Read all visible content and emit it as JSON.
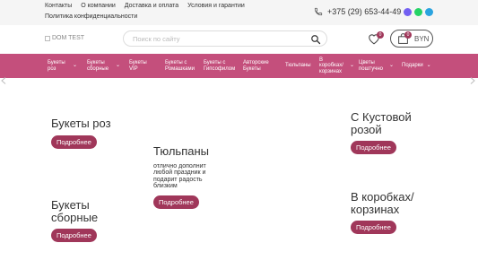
{
  "topbar": {
    "links_row1": [
      "Контакты",
      "О компании",
      "Доставка и оплата",
      "Условия и гарантии"
    ],
    "links_row2": [
      "Политика конфиденциальности"
    ],
    "phone": "+375 (29) 653-44-49",
    "messengers": [
      {
        "icon": "viber-icon",
        "color": "#7360f2"
      },
      {
        "icon": "whatsapp-icon",
        "color": "#25d366"
      },
      {
        "icon": "telegram-icon",
        "color": "#2aa3df"
      }
    ]
  },
  "header": {
    "logo_alt": "DOM TEST",
    "search_placeholder": "Поиск по сайту",
    "favorites_count": "0",
    "cart_count": "0",
    "currency": "BYN"
  },
  "nav": {
    "items": [
      {
        "label": "Букеты роз",
        "dropdown": true
      },
      {
        "label": "Букеты сборные",
        "dropdown": true
      },
      {
        "label": "Букеты VIP",
        "dropdown": false
      },
      {
        "label": "Букеты с Ромашками",
        "dropdown": false
      },
      {
        "label": "Букеты с Гипсофилом",
        "dropdown": false
      },
      {
        "label": "Авторские Букеты",
        "dropdown": false
      },
      {
        "label": "Тюльпаны",
        "dropdown": false
      },
      {
        "label": "В коробках/ корзинах",
        "dropdown": true
      },
      {
        "label": "Цветы поштучно",
        "dropdown": true
      },
      {
        "label": "Подарки",
        "dropdown": true
      }
    ]
  },
  "categories": [
    {
      "title": "Букеты роз",
      "desc": "",
      "button": "Подробнее"
    },
    {
      "title": "Тюльпаны",
      "desc": "отлично дополнит любой праздник и подарит радость близким",
      "button": "Подробнее"
    },
    {
      "title": "С Кустовой розой",
      "desc": "",
      "button": "Подробнее"
    },
    {
      "title": "Букеты сборные",
      "desc": "",
      "button": "Подробнее"
    },
    {
      "title": "В коробках/ корзинах",
      "desc": "",
      "button": "Подробнее"
    }
  ],
  "colors": {
    "accent": "#c44f7c",
    "button": "#a0375a"
  }
}
